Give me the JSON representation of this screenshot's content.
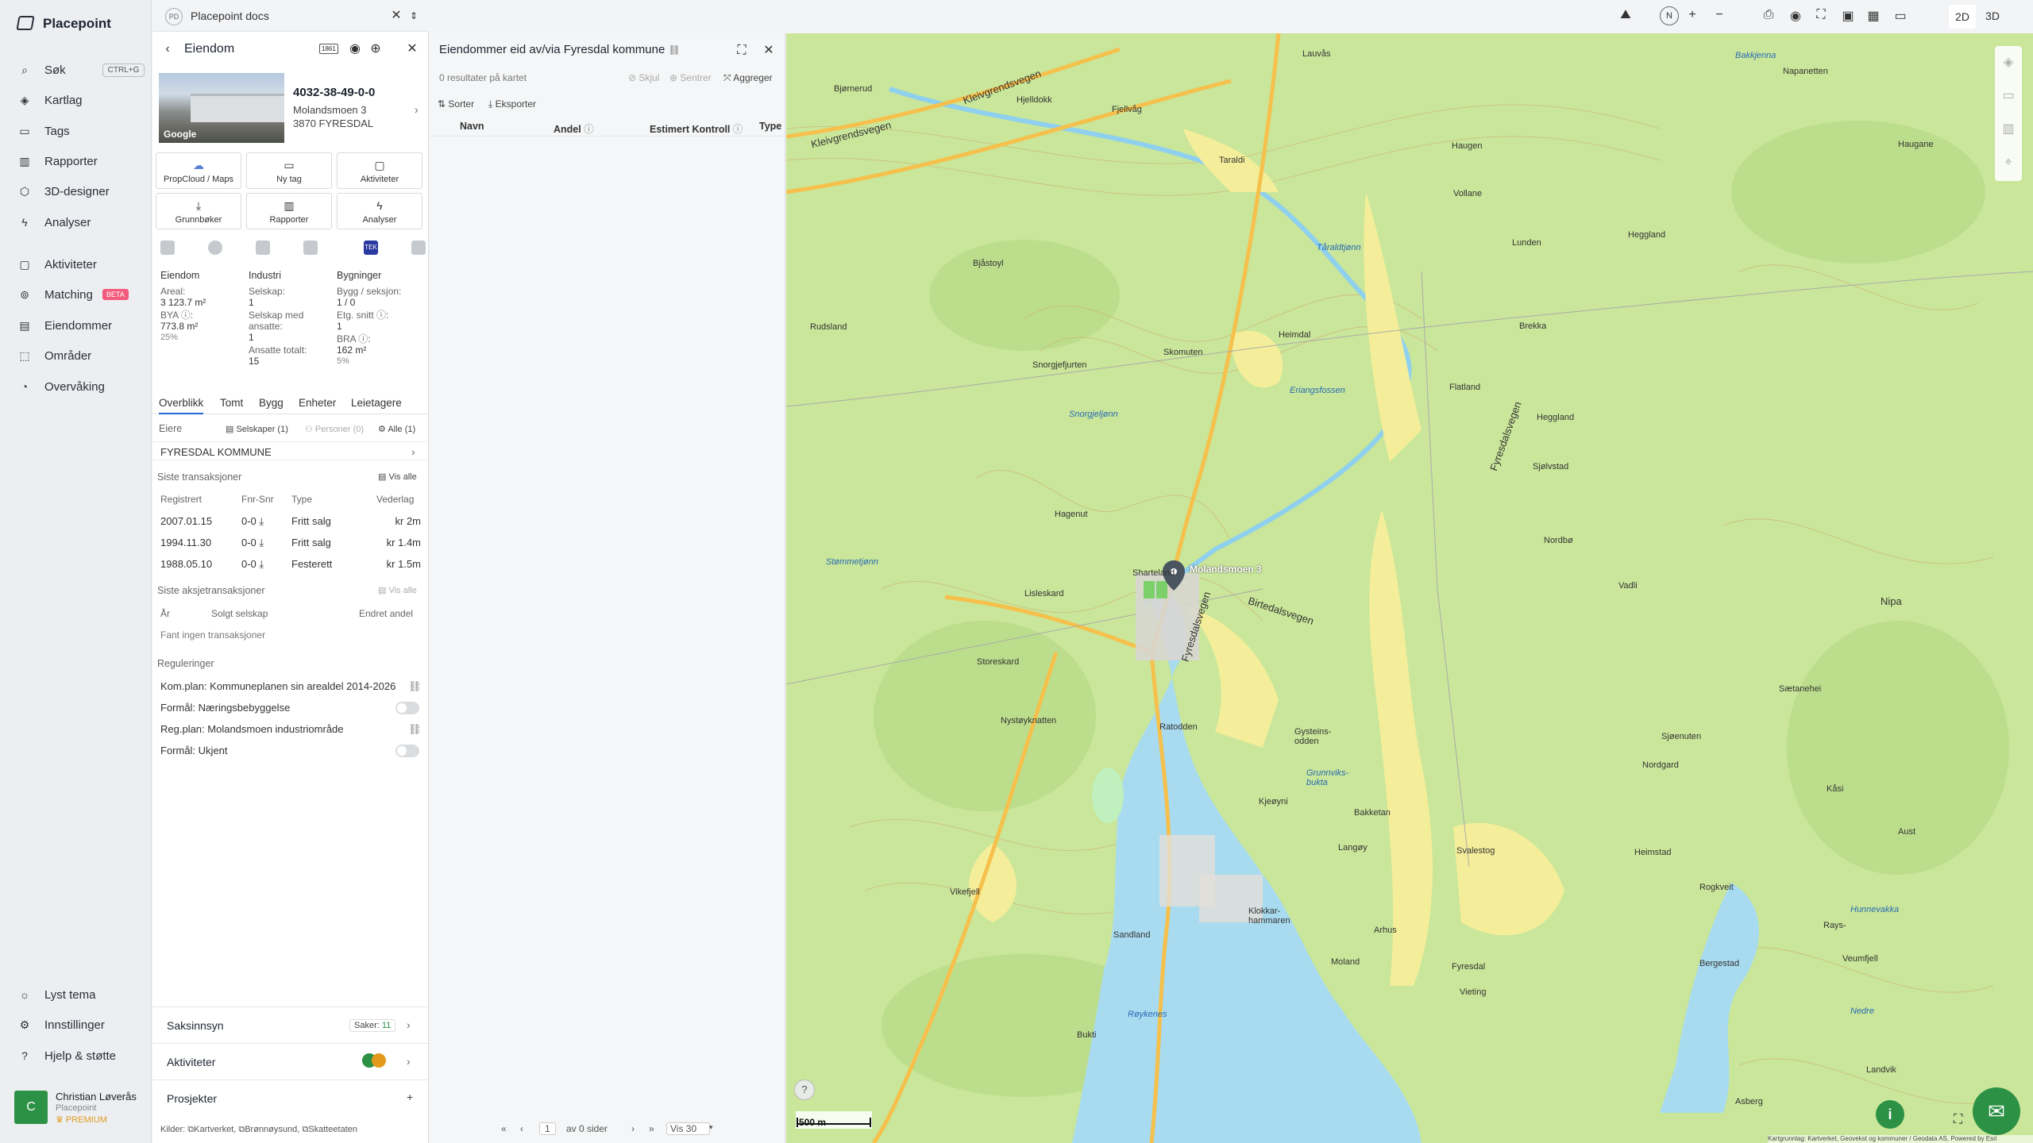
{
  "app": {
    "name": "Placepoint"
  },
  "nav": {
    "items": [
      {
        "label": "Søk",
        "icon": "search-icon",
        "shortcut": "CTRL+G"
      },
      {
        "label": "Kartlag",
        "icon": "layers-icon"
      },
      {
        "label": "Tags",
        "icon": "bookmark-icon"
      },
      {
        "label": "Rapporter",
        "icon": "chart-icon"
      },
      {
        "label": "3D-designer",
        "icon": "cube-icon"
      },
      {
        "label": "Analyser",
        "icon": "bolt-icon"
      },
      {
        "label": "Aktiviteter",
        "icon": "message-icon"
      },
      {
        "label": "Matching",
        "icon": "link-icon",
        "badge": "BETA"
      },
      {
        "label": "Eiendommer",
        "icon": "building-icon"
      },
      {
        "label": "Områder",
        "icon": "area-icon"
      },
      {
        "label": "Overvåking",
        "icon": "gauge-icon"
      }
    ],
    "bottom": [
      {
        "label": "Lyst tema",
        "icon": "sun-icon"
      },
      {
        "label": "Innstillinger",
        "icon": "gear-icon"
      },
      {
        "label": "Hjelp & støtte",
        "icon": "help-icon"
      }
    ],
    "user": {
      "initial": "C",
      "name": "Christian Løverås",
      "org": "Placepoint",
      "plan": "PREMIUM"
    }
  },
  "panel1": {
    "tab": {
      "badge": "PD",
      "title": "Placepoint docs"
    },
    "title": "Eiendom",
    "header_badge": "1861",
    "property": {
      "id": "4032-38-49-0-0",
      "address": "Molandsmoen 3",
      "postal": "3870 FYRESDAL",
      "photo_label": "Google"
    },
    "actions": [
      {
        "label": "PropCloud / Maps",
        "icon": "cloud-icon"
      },
      {
        "label": "Ny tag",
        "icon": "bookmark-icon"
      },
      {
        "label": "Aktiviteter",
        "icon": "message-icon"
      },
      {
        "label": "Grunnbøker",
        "icon": "download-icon"
      },
      {
        "label": "Rapporter",
        "icon": "chart-icon"
      },
      {
        "label": "Analyser",
        "icon": "bolt-icon"
      }
    ],
    "tek_badge": "TEK",
    "stats": {
      "col1": {
        "head": "Eiendom",
        "areal_label": "Areal:",
        "areal": "3 123.7",
        "areal_unit": "m²",
        "bya_label": "BYA ⓘ:",
        "bya": "773.8",
        "bya_unit": "m²",
        "bya_pct": "25%"
      },
      "col2": {
        "head": "Industri",
        "selskap_label": "Selskap:",
        "selskap": "1",
        "ansatte_label": "Selskap med ansatte:",
        "ansatte": "1",
        "totalt_label": "Ansatte totalt:",
        "totalt": "15"
      },
      "col3": {
        "head": "Bygninger",
        "bygg_label": "Bygg / seksjon:",
        "bygg": "1 / 0",
        "etg_label": "Etg. snitt ⓘ:",
        "etg": "1",
        "bra_label": "BRA ⓘ:",
        "bra": "162",
        "bra_unit": "m²",
        "bra_pct": "5%"
      }
    },
    "tabs": [
      "Overblikk",
      "Tomt",
      "Bygg",
      "Enheter",
      "Leietagere"
    ],
    "owners": {
      "label": "Eiere",
      "f1": "Selskaper (1)",
      "f2": "Personer (0)",
      "f3": "Alle (1)",
      "owner": "FYRESDAL KOMMUNE"
    },
    "transactions": {
      "label": "Siste transaksjoner",
      "vis_alle": "Vis alle",
      "cols": [
        "Registrert",
        "Fnr-Snr",
        "Type",
        "Vederlag"
      ],
      "rows": [
        {
          "date": "2007.01.15",
          "fnr": "0-0",
          "type": "Fritt salg",
          "price": "kr 2m"
        },
        {
          "date": "1994.11.30",
          "fnr": "0-0",
          "type": "Fritt salg",
          "price": "kr 1.4m"
        },
        {
          "date": "1988.05.10",
          "fnr": "0-0",
          "type": "Festerett",
          "price": "kr 1.5m"
        }
      ]
    },
    "share_tx": {
      "label": "Siste aksjetransaksjoner",
      "vis_alle": "Vis alle",
      "cols": [
        "År",
        "Solgt selskap",
        "Endret andel"
      ],
      "empty": "Fant ingen transaksjoner"
    },
    "regulations": {
      "label": "Reguleringer",
      "items": [
        "Kom.plan: Kommuneplanen sin arealdel 2014-2026",
        "Formål: Næringsbebyggelse",
        "Reg.plan: Molandsmoen industriområde",
        "Formål: Ukjent"
      ]
    },
    "bottom": {
      "saksinnsyn": "Saksinnsyn",
      "saker_label": "Saker:",
      "saker_count": "11",
      "aktiviteter": "Aktiviteter",
      "prosjekter": "Prosjekter",
      "kilder": "Kilder:",
      "src1": "Kartverket,",
      "src2": "Brønnøysund,",
      "src3": "Skatteetaten"
    }
  },
  "panel2": {
    "title": "Eiendommer eid av/via Fyresdal kommune",
    "result_text": "0 resultater på kartet",
    "skjul": "Skjul",
    "sentrer": "Sentrer",
    "aggreger": "Aggreger",
    "sorter": "Sorter",
    "eksporter": "Eksporter",
    "cols": [
      "Navn",
      "Andel",
      "Estimert Kontroll",
      "Type"
    ],
    "pagination": {
      "page": "1",
      "of_pages": "av 0 sider",
      "per_page": "Vis 30"
    }
  },
  "map": {
    "toolbar": {
      "d2": "2D",
      "d3": "3D"
    },
    "scale": "500 m",
    "attribution": "Kartgrunnlag: Kartverket, Geovekst og kommuner / Geodata AS, Powered by Esri",
    "labels": [
      "Kleivgrendsvegen",
      "Lauvås",
      "Bjørnerud",
      "Hjelldokk",
      "Fjellvåg",
      "Kleivgrendsvegen",
      "Napanetten",
      "Bakkjenna",
      "Haugane",
      "Haugen",
      "Taraldi",
      "Vollane",
      "Lunden",
      "Tåraldtjønn",
      "Bjåstoyl",
      "Heggland",
      "Rudsland",
      "Heimdal",
      "Skomuten",
      "Flatland",
      "Brekka",
      "Snorgjefjurten",
      "Eriangsfossen",
      "Snorgjeljønn",
      "Fyresdalsvegen",
      "Heggland",
      "Sjølvstad",
      "Hagenut",
      "Nordbø",
      "Sharteland",
      "Lisleskard",
      "Birtedalsvegen",
      "Fyresdalsvegen",
      "Stømmetjønn",
      "Storeskard",
      "Nystøyknatten",
      "Ratodden",
      "Gysteins-odden",
      "Grunnviks-bukta",
      "Kjeøyni",
      "Bakketan",
      "Svalestog",
      "Langøy",
      "Vikefjell",
      "Klokkar-hammaren",
      "Sandland",
      "Arhus",
      "Moland",
      "Fyresdal",
      "Vieting",
      "Røykenes",
      "Bukti",
      "Nipa",
      "Sætanehei",
      "Sjøenuten",
      "Nordgard",
      "Heimstad",
      "Rays-",
      "Hunnevakka",
      "Nedre",
      "Landvik",
      "Asberg",
      "Molandsmoen 3",
      "Rogkveit",
      "Vadli",
      "Aust",
      "Veumfjell",
      "Kåsi",
      "Bergestad"
    ]
  }
}
